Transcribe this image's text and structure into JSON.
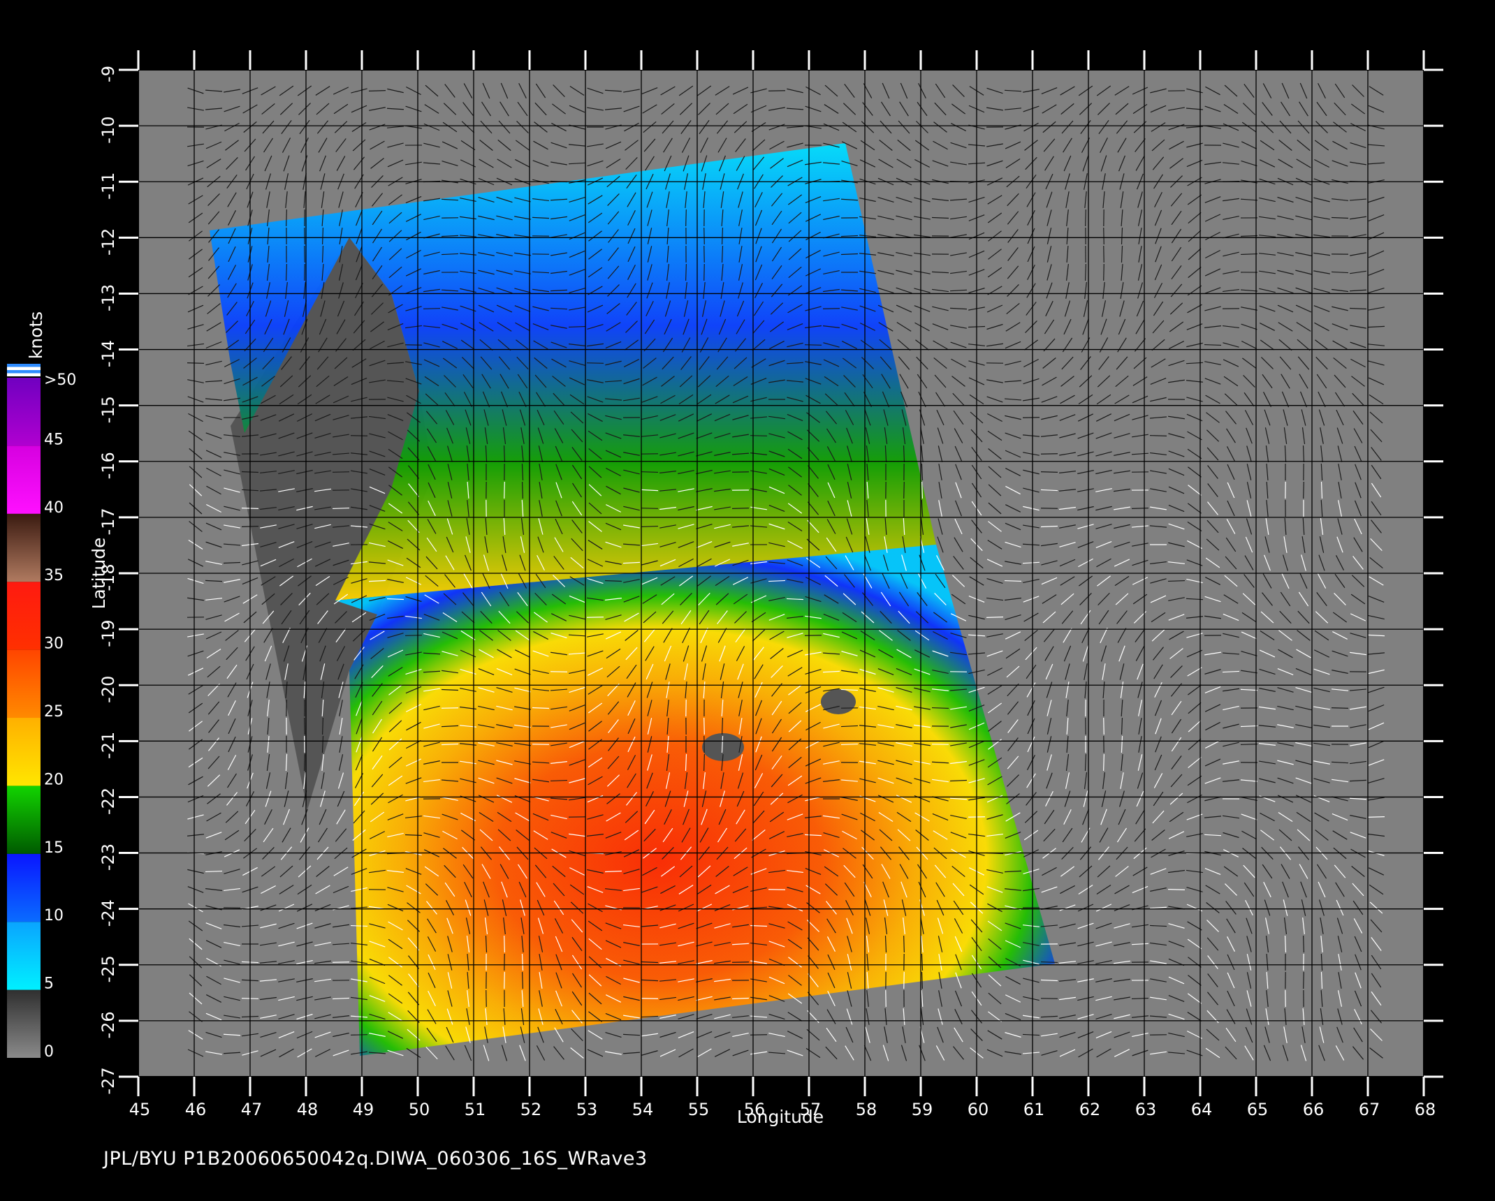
{
  "x_axis": {
    "title": "Longitude",
    "ticks": [
      45,
      46,
      47,
      48,
      49,
      50,
      51,
      52,
      53,
      54,
      55,
      56,
      57,
      58,
      59,
      60,
      61,
      62,
      63,
      64,
      65,
      66,
      67,
      68
    ]
  },
  "y_axis": {
    "title": "Latitude",
    "ticks": [
      -9,
      -10,
      -11,
      -12,
      -13,
      -14,
      -15,
      -16,
      -17,
      -18,
      -19,
      -20,
      -21,
      -22,
      -23,
      -24,
      -25,
      -26,
      -27
    ]
  },
  "colorbar": {
    "units": "knots",
    "labels": [
      "0",
      "5",
      "10",
      "15",
      "20",
      "25",
      "30",
      "35",
      "40",
      "45",
      ">50"
    ],
    "bands": [
      {
        "from": 0,
        "to": 5,
        "colors": [
          "#8a8a8a",
          "#2f2f2f"
        ]
      },
      {
        "from": 5,
        "to": 10,
        "colors": [
          "#00f0ff",
          "#0aa4ff"
        ]
      },
      {
        "from": 10,
        "to": 15,
        "colors": [
          "#0a6cff",
          "#0a16ff"
        ]
      },
      {
        "from": 15,
        "to": 20,
        "colors": [
          "#005a00",
          "#12d400"
        ]
      },
      {
        "from": 20,
        "to": 25,
        "colors": [
          "#ffe600",
          "#ffb000"
        ]
      },
      {
        "from": 25,
        "to": 30,
        "colors": [
          "#ff8a00",
          "#ff4500"
        ]
      },
      {
        "from": 30,
        "to": 35,
        "colors": [
          "#ff3000",
          "#ff1a10"
        ]
      },
      {
        "from": 35,
        "to": 40,
        "colors": [
          "#b07a60",
          "#3a1a10"
        ]
      },
      {
        "from": 40,
        "to": 45,
        "colors": [
          "#ff10ff",
          "#d600e0"
        ]
      },
      {
        "from": 45,
        "to": 50,
        "colors": [
          "#b000d0",
          "#7000c0"
        ]
      }
    ],
    "top_stripes": [
      "#2d8bff",
      "#ffffff",
      "#2d8bff",
      "#ffffff"
    ]
  },
  "map": {
    "background_color": "#808080",
    "land_color": "#555555"
  },
  "caption": "JPL/BYU  P1B20060650042q.DIWA_060306_16S_WRave3"
}
